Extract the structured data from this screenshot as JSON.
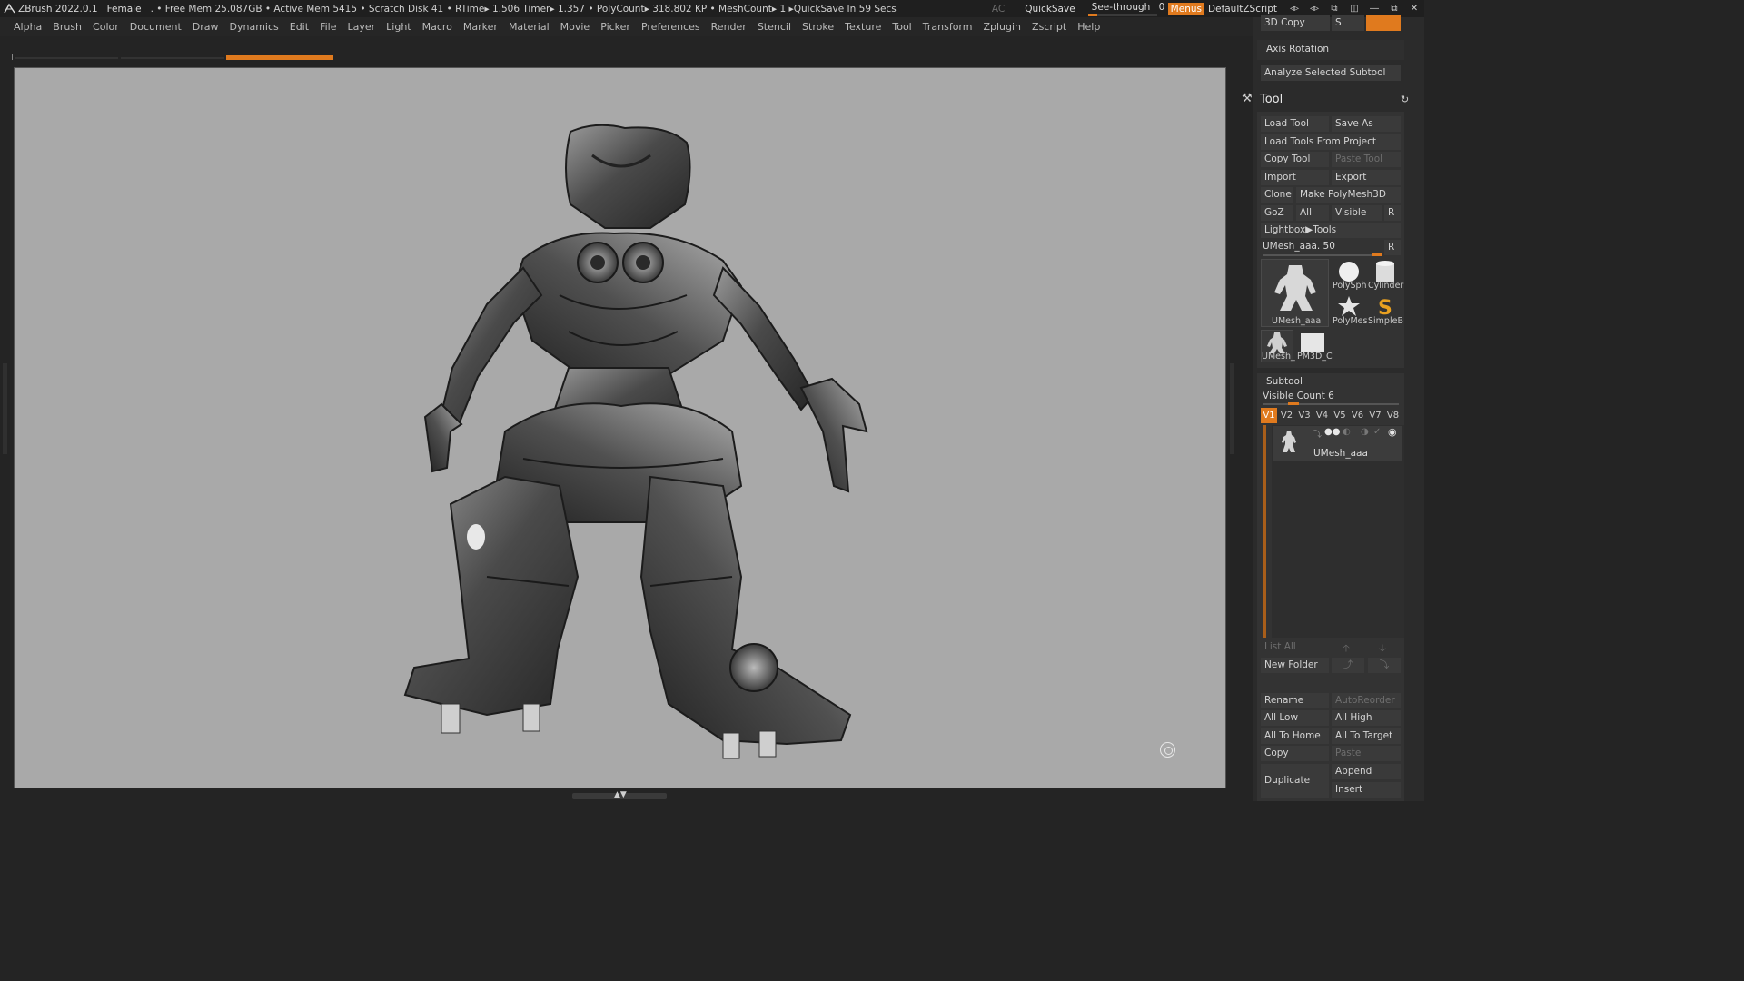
{
  "app": {
    "title": "ZBrush 2022.0.1",
    "document": "Female",
    "status": ". • Free Mem 25.087GB • Active Mem 5415 • Scratch Disk 41 •  RTime▸ 1.506 Timer▸ 1.357 • PolyCount▸ 318.802 KP  • MeshCount▸ 1  ▸QuickSave In 59 Secs",
    "ac": "AC",
    "quicksave": "QuickSave",
    "see_through_label": "See-through",
    "see_through_value": "0",
    "see_through_level": 0,
    "menus": "Menus",
    "script": "DefaultZScript"
  },
  "menubar": {
    "items": [
      "Alpha",
      "Brush",
      "Color",
      "Document",
      "Draw",
      "Dynamics",
      "Edit",
      "File",
      "Layer",
      "Light",
      "Macro",
      "Marker",
      "Material",
      "Movie",
      "Picker",
      "Preferences",
      "Render",
      "Stencil",
      "Stroke",
      "Texture",
      "Tool",
      "Transform",
      "Zplugin",
      "Zscript",
      "Help"
    ]
  },
  "colors": {
    "accent": "#e07a1e",
    "canvas_bg": "#a9a9a9",
    "panel_bg": "#2b2b2b"
  },
  "panel": {
    "top": {
      "copy_3d": "3D Copy",
      "s_label": "S",
      "axis_rotation": "Axis Rotation",
      "analyze": "Analyze Selected Subtool"
    },
    "tool": {
      "title": "Tool",
      "buttons": {
        "load_tool": "Load Tool",
        "save_as": "Save As",
        "load_from_project": "Load Tools From Project",
        "copy_tool": "Copy Tool",
        "paste_tool": "Paste Tool",
        "import": "Import",
        "export": "Export",
        "clone": "Clone",
        "make_polymesh": "Make PolyMesh3D",
        "goz": "GoZ",
        "all": "All",
        "visible": "Visible",
        "r": "R",
        "lightbox_tools": "Lightbox▶Tools"
      },
      "current_tool": "UMesh_aaa. 50",
      "current_tool_r": "R",
      "thumbs": {
        "main": "UMesh_aaa",
        "polysphere": "PolySph",
        "cylinder": "Cylinder",
        "polymesh": "PolyMes",
        "simpleb": "SimpleB",
        "umesh_small": "UMesh_",
        "pm3d": "PM3D_C"
      }
    },
    "subtool": {
      "title": "Subtool",
      "visible_count": "Visible Count 6",
      "tabs": [
        "V1",
        "V2",
        "V3",
        "V4",
        "V5",
        "V6",
        "V7",
        "V8"
      ],
      "active_tab": "V1",
      "items": [
        {
          "name": "UMesh_aaa"
        }
      ],
      "list_all": "List All",
      "new_folder": "New Folder",
      "rename": "Rename",
      "autoreorder": "AutoReorder",
      "all_low": "All Low",
      "all_high": "All High",
      "all_to_home": "All To Home",
      "all_to_target": "All To Target",
      "copy": "Copy",
      "paste": "Paste",
      "duplicate": "Duplicate",
      "append": "Append",
      "insert": "Insert"
    }
  },
  "icons": {
    "logo": "zbrush-logo-icon",
    "tool": "hammer-icon",
    "refresh": "refresh-icon",
    "gizmo": "gizmo-icon",
    "eye": "eye-icon",
    "arrow_up": "arrow-up-icon",
    "arrow_down": "arrow-down-icon"
  }
}
